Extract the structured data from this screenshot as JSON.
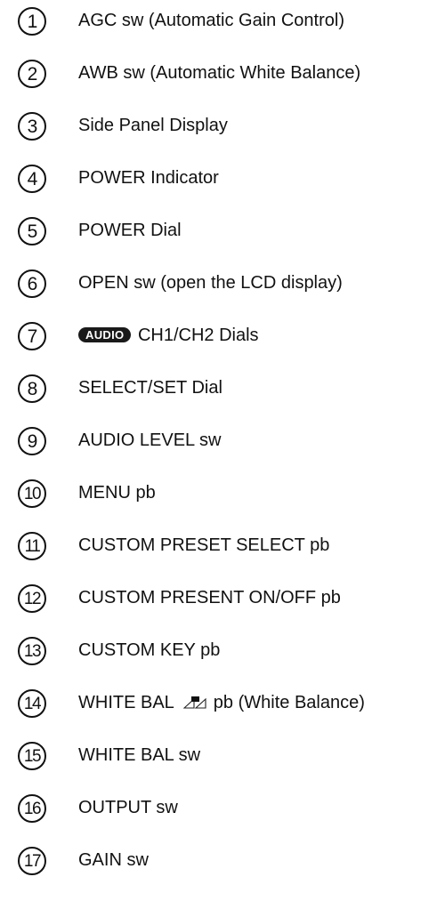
{
  "items": [
    {
      "num": "1",
      "label": "AGC sw (Automatic Gain Control)"
    },
    {
      "num": "2",
      "label": "AWB sw (Automatic White Balance)"
    },
    {
      "num": "3",
      "label": "Side Panel Display"
    },
    {
      "num": "4",
      "label": "POWER Indicator"
    },
    {
      "num": "5",
      "label": "POWER Dial"
    },
    {
      "num": "6",
      "label": "OPEN sw (open the LCD display)"
    },
    {
      "num": "7",
      "badge": "AUDIO",
      "label": "CH1/CH2 Dials"
    },
    {
      "num": "8",
      "label": "SELECT/SET Dial"
    },
    {
      "num": "9",
      "label": "AUDIO LEVEL sw"
    },
    {
      "num": "10",
      "label": "MENU pb"
    },
    {
      "num": "11",
      "label": "CUSTOM PRESET SELECT pb"
    },
    {
      "num": "12",
      "label": "CUSTOM PRESENT ON/OFF pb"
    },
    {
      "num": "13",
      "label": "CUSTOM KEY pb"
    },
    {
      "num": "14",
      "label_before": "WHITE BAL",
      "icon": "white-balance-icon",
      "label_after": "pb (White Balance)"
    },
    {
      "num": "15",
      "label": "WHITE BAL sw"
    },
    {
      "num": "16",
      "label": "OUTPUT sw"
    },
    {
      "num": "17",
      "label": "GAIN sw"
    }
  ]
}
